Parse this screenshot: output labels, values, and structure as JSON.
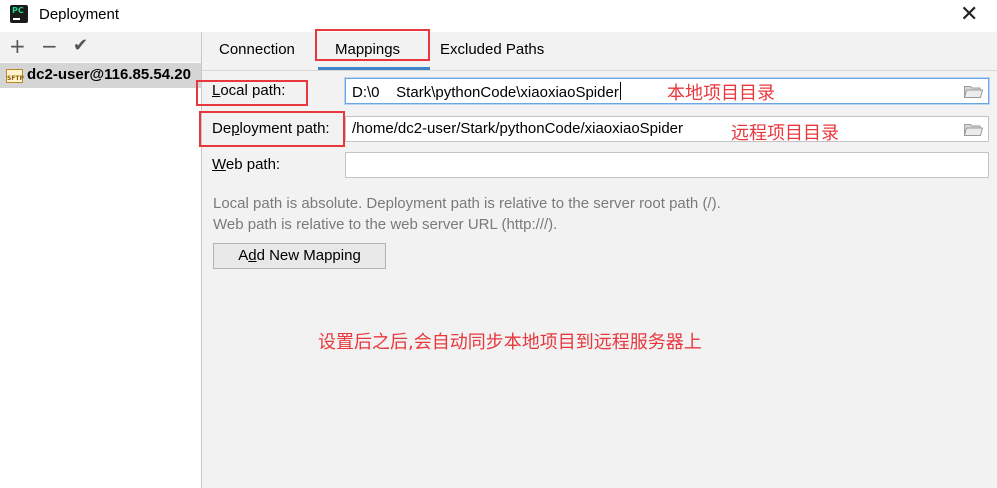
{
  "window": {
    "title": "Deployment",
    "app_icon_label": "PC",
    "close_glyph": "✕"
  },
  "toolbar": {
    "add_glyph": "+",
    "remove_glyph": "−",
    "apply_glyph": "✔"
  },
  "servers": [
    {
      "label": "dc2-user@116.85.54.20",
      "icon": "sftp-icon",
      "icon_text": "SFTP",
      "selected": true
    }
  ],
  "tabs": [
    {
      "label": "Connection",
      "active": false
    },
    {
      "label": "Mappings",
      "active": true
    },
    {
      "label": "Excluded Paths",
      "active": false
    }
  ],
  "mappings": {
    "local_path": {
      "label_mnemonic": "L",
      "label_rest": "ocal path:",
      "value": "D:\\0    Stark\\pythonCode\\xiaoxiaoSpider"
    },
    "deployment_path": {
      "label_pre": "De",
      "label_mnemonic": "p",
      "label_rest": "loyment path:",
      "value": "/home/dc2-user/Stark/pythonCode/xiaoxiaoSpider"
    },
    "web_path": {
      "label_mnemonic": "W",
      "label_rest": "eb path:",
      "value": ""
    },
    "help_line_1": "Local path is absolute. Deployment path is relative to the server root path (/).",
    "help_line_2": "Web path is relative to the web server URL (http:///).",
    "add_button": {
      "label_pre": "A",
      "label_mnemonic": "d",
      "label_rest": "d New Mapping"
    }
  },
  "annotations": {
    "local_note": "本地项目目录",
    "remote_note": "远程项目目录",
    "sync_note": "设置后之后,会自动同步本地项目到远程服务器上",
    "color": "#e8383d"
  },
  "colors": {
    "accent": "#4083c9",
    "selection": "#d5d5d5",
    "background": "#f2f2f2"
  }
}
